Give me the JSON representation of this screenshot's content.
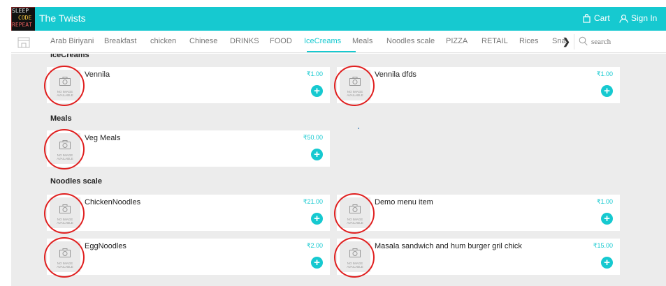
{
  "header": {
    "logo_lines": [
      "SLEEP",
      "CODE",
      "REPEAT"
    ],
    "app_title": "The Twists",
    "cart_label": "Cart",
    "signin_label": "Sign In",
    "brand_color": "#16c9d0"
  },
  "nav": {
    "categories": [
      "Arab Biriyani",
      "Breakfast",
      "chicken",
      "Chinese",
      "DRINKS",
      "FOOD",
      "IceCreams",
      "Meals",
      "Noodles scale",
      "PIZZA",
      "RETAIL",
      "Rices",
      "Sna"
    ],
    "active_category": "IceCreams",
    "scroll_arrow": "❯",
    "search_placeholder": "search"
  },
  "sections": [
    {
      "title": "IceCreams",
      "items": [
        {
          "name": "Vennila",
          "price": "₹1.00",
          "image_text": "NO IMAGE AVAILABLE"
        },
        {
          "name": "Vennila dfds",
          "price": "₹1.00",
          "image_text": "NO IMAGE AVAILABLE"
        }
      ]
    },
    {
      "title": "Meals",
      "items": [
        {
          "name": "Veg Meals",
          "price": "₹50.00",
          "image_text": "NO IMAGE AVAILABLE"
        }
      ]
    },
    {
      "title": "Noodles scale",
      "items": [
        {
          "name": "ChickenNoodles",
          "price": "₹21.00",
          "image_text": "NO IMAGE AVAILABLE"
        },
        {
          "name": "Demo menu item",
          "price": "₹1.00",
          "image_text": "NO IMAGE AVAILABLE"
        },
        {
          "name": "EggNoodles",
          "price": "₹2.00",
          "image_text": "NO IMAGE AVAILABLE"
        },
        {
          "name": "Masala sandwich and hum burger gril chick",
          "price": "₹15.00",
          "image_text": "NO IMAGE AVAILABLE"
        }
      ]
    }
  ],
  "add_label": "+",
  "annotation_color": "#e02020"
}
